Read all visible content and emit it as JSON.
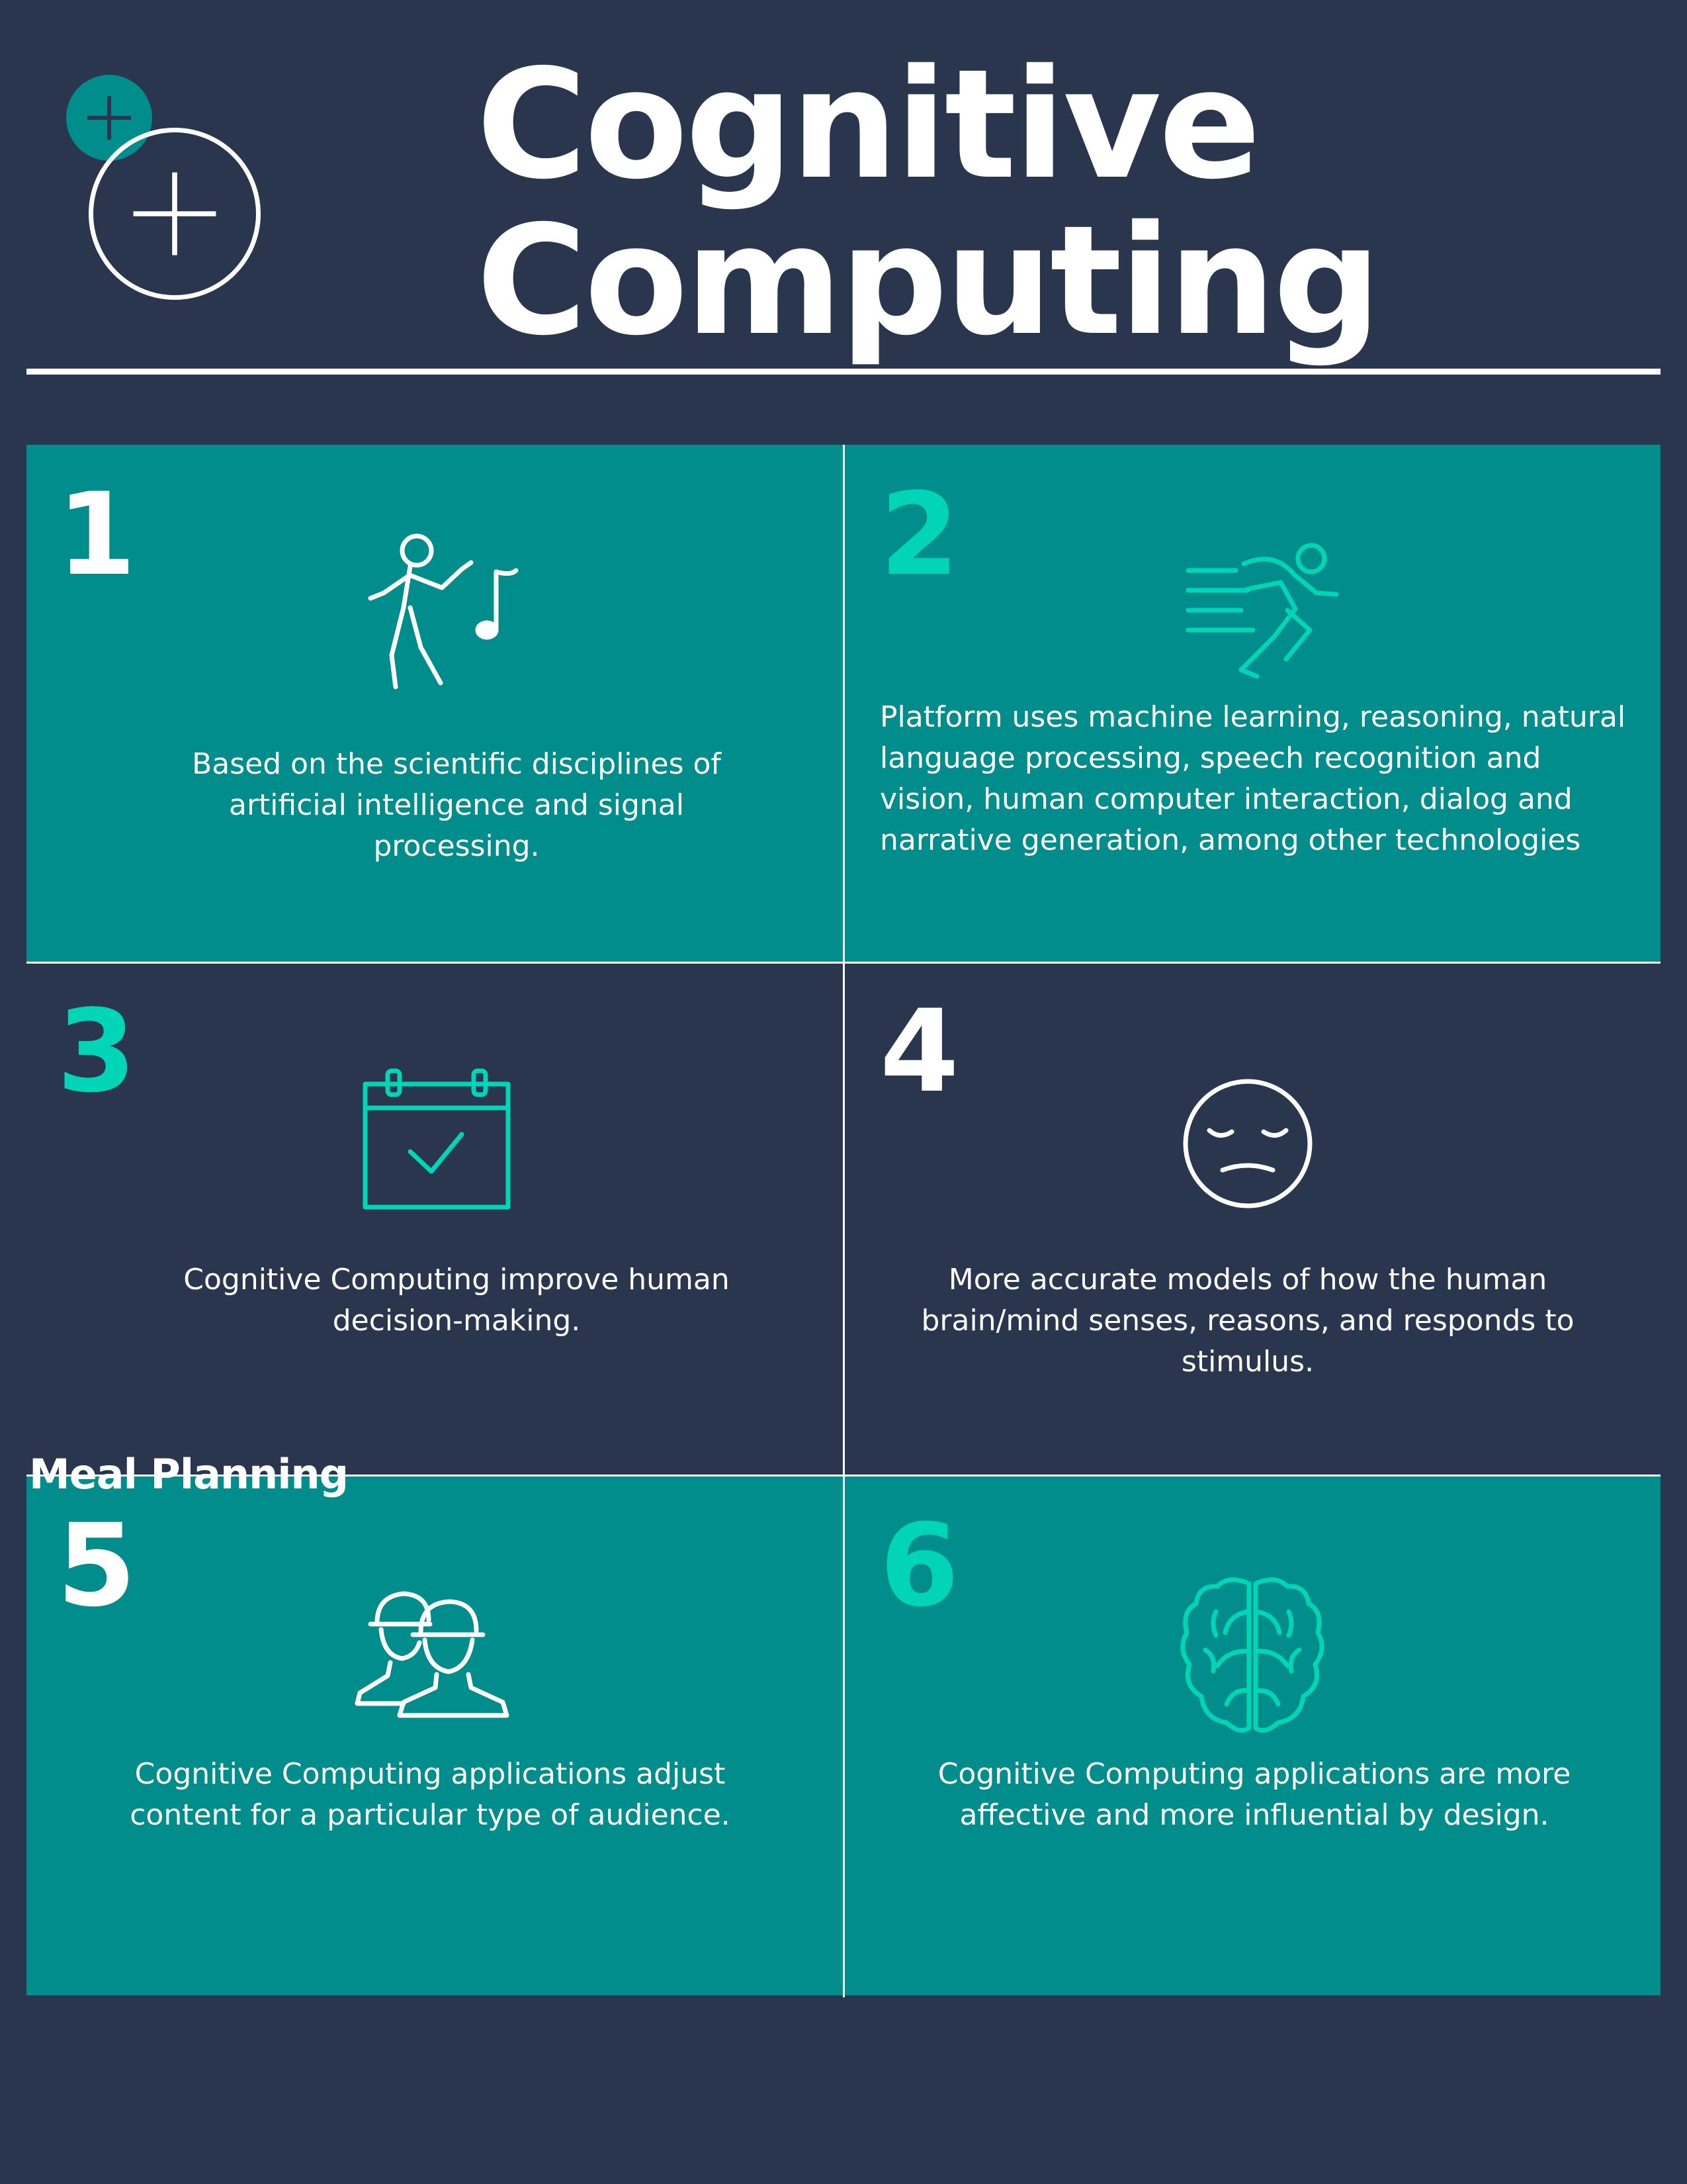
{
  "header": {
    "title_line1": "Cognitive",
    "title_line2": "Computing"
  },
  "stray_label": "Meal Planning",
  "colors": {
    "background": "#29364e",
    "teal": "#008d8b",
    "mint": "#00d6b7",
    "white": "#ffffff"
  },
  "cells": [
    {
      "number": "1",
      "icon": "dancing-person-icon",
      "text": "Based on the scientific disciplines of artificial intelligence and signal processing."
    },
    {
      "number": "2",
      "icon": "sprinting-runner-icon",
      "text": "Platform uses machine learning, reasoning, natural language processing, speech recognition and vision, human computer interaction, dialog and narrative generation, among other technologies"
    },
    {
      "number": "3",
      "icon": "calendar-check-icon",
      "text": "Cognitive Computing improve human decision-making."
    },
    {
      "number": "4",
      "icon": "unamused-face-icon",
      "text": "More accurate models of how the human brain/mind senses, reasons, and responds to stimulus."
    },
    {
      "number": "5",
      "icon": "workers-hardhat-icon",
      "text": "Cognitive Computing applications  adjust content for a particular type of audience."
    },
    {
      "number": "6",
      "icon": "brain-icon",
      "text": "Cognitive Computing applications are more affective and more influential by design."
    }
  ]
}
